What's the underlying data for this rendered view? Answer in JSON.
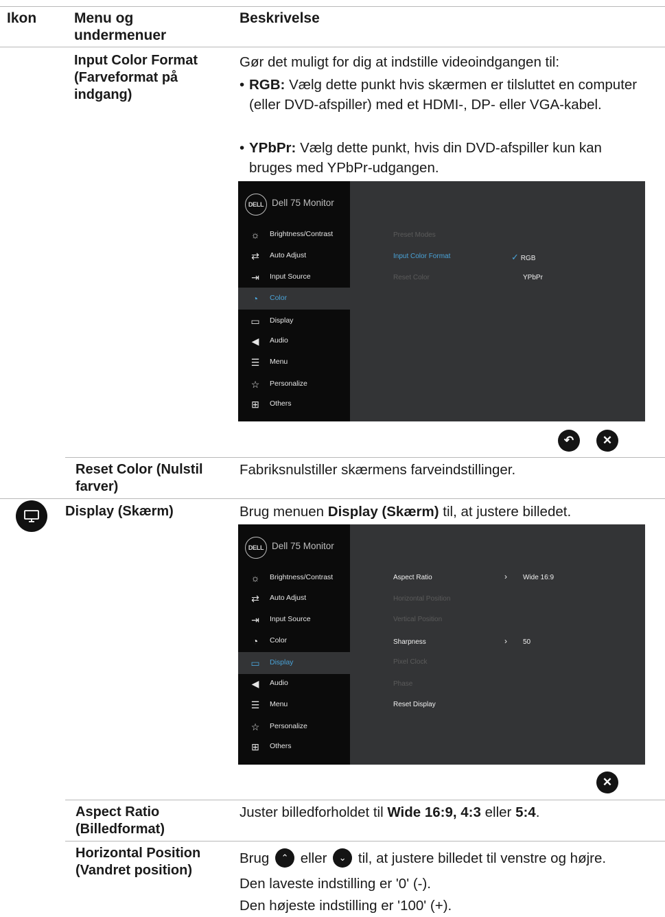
{
  "header": {
    "col_icon": "Ikon",
    "col_menu": "Menu og undermenuer",
    "col_desc": "Beskrivelse"
  },
  "input_color_format": {
    "name": "Input Color Format (Farveformat på indgang)",
    "intro": "Gør det muligt for dig at indstille videoindgangen til:",
    "rgb_term": "RGB:",
    "rgb_text": "Vælg dette punkt hvis skærmen er tilsluttet en computer (eller DVD-afspiller) med et HDMI-, DP- eller VGA-kabel.",
    "ypbpr_term": "YPbPr:",
    "ypbpr_text": "Vælg dette punkt, hvis din DVD-afspiller kun kan bruges med YPbPr-udgangen."
  },
  "osd1": {
    "logo": "DELL",
    "title": "Dell 75 Monitor",
    "menu": [
      "Brightness/Contrast",
      "Auto Adjust",
      "Input Source",
      "Color",
      "Display",
      "Audio",
      "Menu",
      "Personalize",
      "Others"
    ],
    "options": [
      "Preset Modes",
      "Input Color Format",
      "Reset Color"
    ],
    "values": {
      "rgb": "RGB",
      "ypbpr": "YPbPr"
    },
    "check_glyph": "✓"
  },
  "reset_color": {
    "name": "Reset Color (Nulstil farver)",
    "desc": "Fabriksnulstiller skærmens farveindstillinger."
  },
  "display": {
    "name": "Display (Skærm)",
    "desc_pre": "Brug menuen",
    "desc_bold": "Display (Skærm)",
    "desc_post": "til, at justere billedet."
  },
  "osd2": {
    "logo": "DELL",
    "title": "Dell 75 Monitor",
    "menu": [
      "Brightness/Contrast",
      "Auto Adjust",
      "Input Source",
      "Color",
      "Display",
      "Audio",
      "Menu",
      "Personalize",
      "Others"
    ],
    "options": [
      "Aspect Ratio",
      "Horizontal Position",
      "Vertical Position",
      "Sharpness",
      "Pixel Clock",
      "Phase",
      "Reset Display"
    ],
    "aspect_value": "Wide 16:9",
    "sharpness_value": "50",
    "chevron": "›"
  },
  "aspect_ratio": {
    "name": "Aspect Ratio (Billedformat)",
    "desc_pre": "Juster billedforholdet til",
    "b1": "Wide 16:9, 4:3",
    "mid": "eller",
    "b2": "5:4",
    "end": "."
  },
  "horizontal_position": {
    "name": "Horizontal Position (Vandret position)",
    "line1_pre": "Brug",
    "line1_mid": "eller",
    "line1_post": "til, at justere billedet til venstre og højre.",
    "line2": "Den laveste indstilling er '0' (-).",
    "line3": "Den højeste indstilling er '100' (+)."
  },
  "buttons": {
    "back_glyph": "↶",
    "close_glyph": "✕",
    "up_glyph": "⌃",
    "down_glyph": "⌄"
  }
}
